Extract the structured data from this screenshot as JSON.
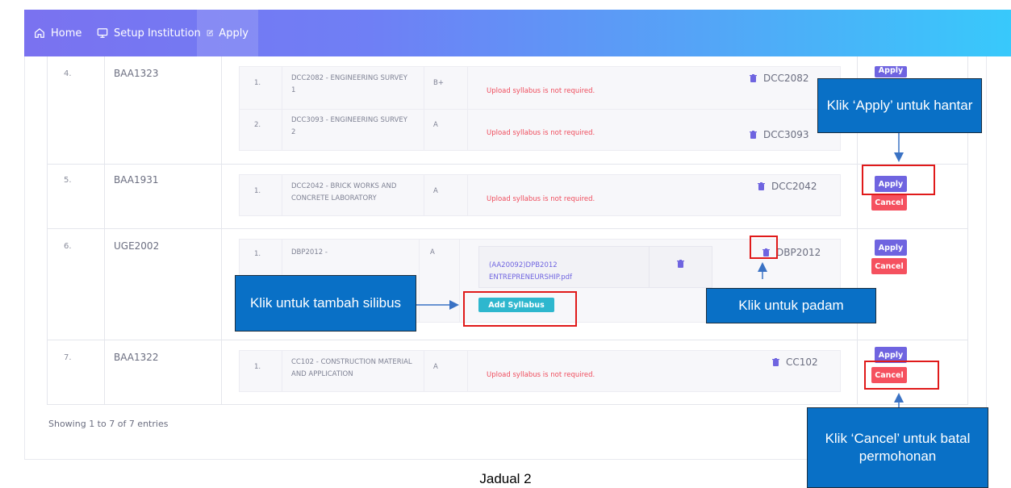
{
  "nav": {
    "home": "Home",
    "setup": "Setup Institution",
    "apply": "Apply"
  },
  "rows": [
    {
      "no": "4.",
      "code": "BAA1323",
      "subjects": [
        {
          "no": "1.",
          "name": "DCC2082 - ENGINEERING SURVEY 1",
          "grade": "B+",
          "status": "Upload syllabus is not required.",
          "code": "DCC2082"
        },
        {
          "no": "2.",
          "name": "DCC3093 - ENGINEERING SURVEY 2",
          "grade": "A",
          "status": "Upload syllabus is not required.",
          "code": "DCC3093"
        }
      ],
      "apply": "Apply"
    },
    {
      "no": "5.",
      "code": "BAA1931",
      "subjects": [
        {
          "no": "1.",
          "name": "DCC2042 - BRICK WORKS AND CONCRETE LABORATORY",
          "grade": "A",
          "status": "Upload syllabus is not required.",
          "code": "DCC2042"
        }
      ],
      "apply": "Apply",
      "cancel": "Cancel"
    },
    {
      "no": "6.",
      "code": "UGE2002",
      "subjects": [
        {
          "no": "1.",
          "name": "DBP2012 -",
          "grade": "A",
          "file": "(AA20092)DPB2012 ENTREPRENEURSHIP.pdf",
          "code": "DBP2012",
          "add_syllabus": "Add Syllabus"
        }
      ],
      "apply": "Apply",
      "cancel": "Cancel"
    },
    {
      "no": "7.",
      "code": "BAA1322",
      "subjects": [
        {
          "no": "1.",
          "name": "CC102 - CONSTRUCTION MATERIAL AND APPLICATION",
          "grade": "A",
          "status": "Upload syllabus is not required.",
          "code": "CC102"
        }
      ],
      "apply": "Apply",
      "cancel": "Cancel"
    }
  ],
  "footer": {
    "showing": "Showing 1 to 7 of 7 entries",
    "caption": "Jadual 2"
  },
  "annotations": {
    "apply_note": "Klik ‘Apply’ untuk hantar",
    "add_syllabus_note": "Klik untuk tambah silibus",
    "delete_note": "Klik untuk padam",
    "cancel_note": "Klik ‘Cancel’ untuk batal permohonan"
  },
  "colors": {
    "accent": "#6f64e0",
    "danger": "#f5515f",
    "info": "#2eb7ce",
    "callout": "#0970c6",
    "highlight": "#e01a1a"
  }
}
